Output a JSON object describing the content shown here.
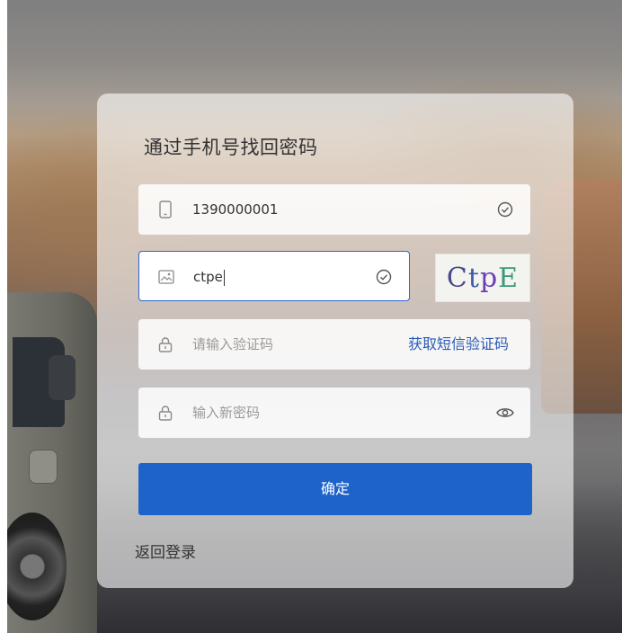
{
  "title": "通过手机号找回密码",
  "phone": {
    "value": "1390000001",
    "icon": "phone-icon",
    "status_icon": "check-circle-icon"
  },
  "captcha": {
    "value": "ctpe",
    "icon": "image-icon",
    "status_icon": "check-circle-icon",
    "image_text": [
      "C",
      "t",
      "p",
      "E"
    ]
  },
  "sms_code": {
    "placeholder": "请输入验证码",
    "icon": "lock-icon",
    "link": "获取短信验证码"
  },
  "new_password": {
    "placeholder": "输入新密码",
    "icon": "lock-icon",
    "toggle_icon": "eye-icon"
  },
  "confirm_button": "确定",
  "back_link": "返回登录",
  "colors": {
    "primary": "#1e63c9",
    "link": "#2b5bb5",
    "focus_border": "#2b67c9"
  }
}
